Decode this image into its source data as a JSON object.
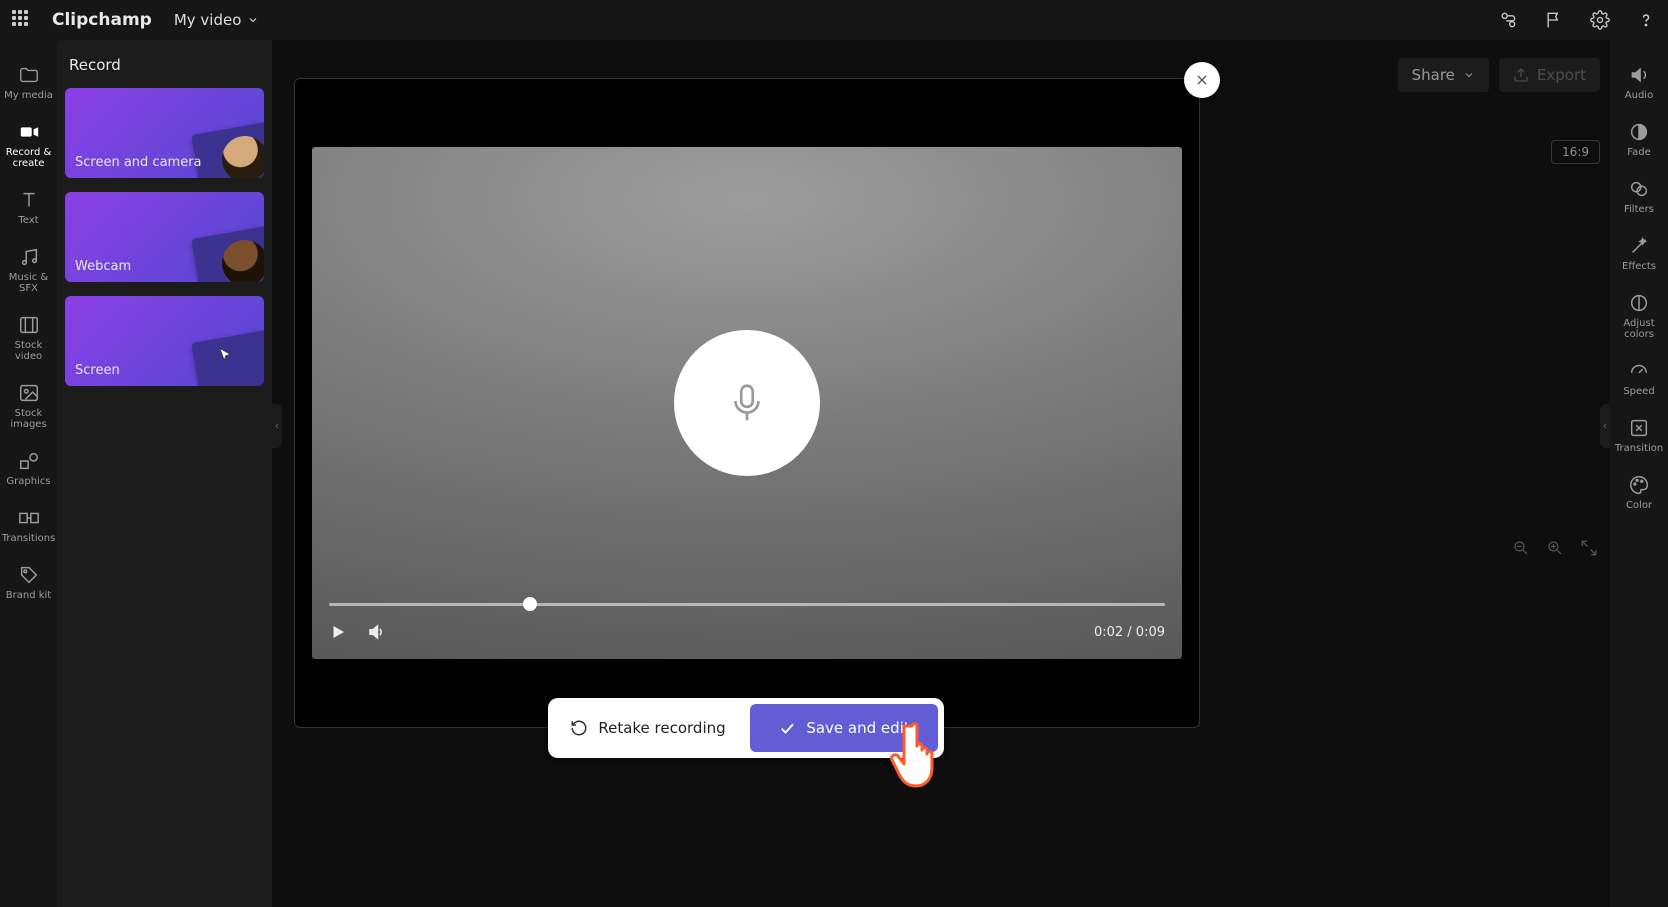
{
  "app": {
    "name": "Clipchamp",
    "project": "My video"
  },
  "topbar": {
    "share": "Share",
    "export": "Export"
  },
  "leftrail": [
    {
      "label": "My media"
    },
    {
      "label": "Record & create",
      "active": true
    },
    {
      "label": "Text"
    },
    {
      "label": "Music & SFX"
    },
    {
      "label": "Stock video"
    },
    {
      "label": "Stock images"
    },
    {
      "label": "Graphics"
    },
    {
      "label": "Transitions"
    },
    {
      "label": "Brand kit"
    }
  ],
  "sidepanel": {
    "heading": "Record",
    "cards": [
      {
        "label": "Screen and camera"
      },
      {
        "label": "Webcam"
      },
      {
        "label": "Screen"
      }
    ]
  },
  "rightrail": [
    {
      "label": "Audio"
    },
    {
      "label": "Fade"
    },
    {
      "label": "Filters"
    },
    {
      "label": "Effects"
    },
    {
      "label": "Adjust colors"
    },
    {
      "label": "Speed"
    },
    {
      "label": "Transition"
    },
    {
      "label": "Color"
    }
  ],
  "aspect": "16:9",
  "playback": {
    "elapsed": "0:02",
    "total": "0:09",
    "time_display": "0:02 / 0:09",
    "progress_pct": 24
  },
  "dialog": {
    "retake": "Retake recording",
    "save": "Save and edit"
  }
}
